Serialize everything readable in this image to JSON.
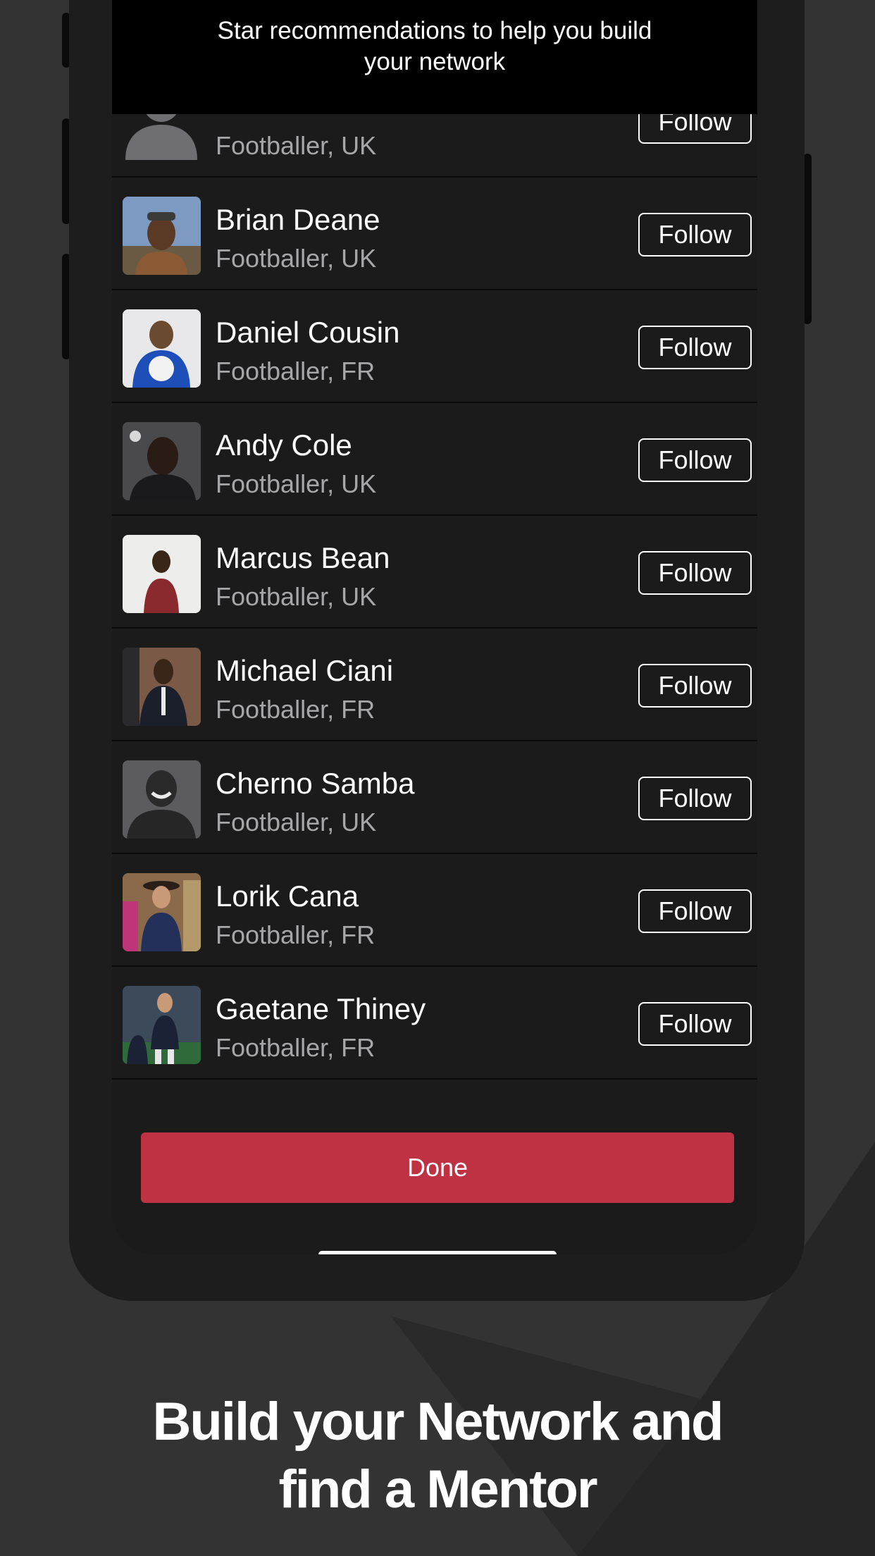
{
  "banner": {
    "line1": "Star recommendations to help you build",
    "line2": "your network"
  },
  "people": [
    {
      "name": "",
      "role": "Footballer, UK",
      "follow": "Follow",
      "photo": "avatar-placeholder-icon"
    },
    {
      "name": "Brian Deane",
      "role": "Footballer, UK",
      "follow": "Follow",
      "photo": "person-photo"
    },
    {
      "name": "Daniel Cousin",
      "role": "Footballer, FR",
      "follow": "Follow",
      "photo": "person-photo"
    },
    {
      "name": "Andy Cole",
      "role": "Footballer, UK",
      "follow": "Follow",
      "photo": "person-photo"
    },
    {
      "name": "Marcus Bean",
      "role": "Footballer, UK",
      "follow": "Follow",
      "photo": "person-photo"
    },
    {
      "name": "Michael Ciani",
      "role": "Footballer, FR",
      "follow": "Follow",
      "photo": "person-photo"
    },
    {
      "name": "Cherno Samba",
      "role": "Footballer, UK",
      "follow": "Follow",
      "photo": "person-photo"
    },
    {
      "name": "Lorik Cana",
      "role": "Footballer, FR",
      "follow": "Follow",
      "photo": "person-photo"
    },
    {
      "name": "Gaetane Thiney",
      "role": "Footballer, FR",
      "follow": "Follow",
      "photo": "person-photo"
    }
  ],
  "done_label": "Done",
  "headline": {
    "line1": "Build your Network and",
    "line2": "find a Mentor"
  },
  "colors": {
    "accent": "#bf3243",
    "background": "#333334",
    "screen": "#1b1b1c"
  }
}
